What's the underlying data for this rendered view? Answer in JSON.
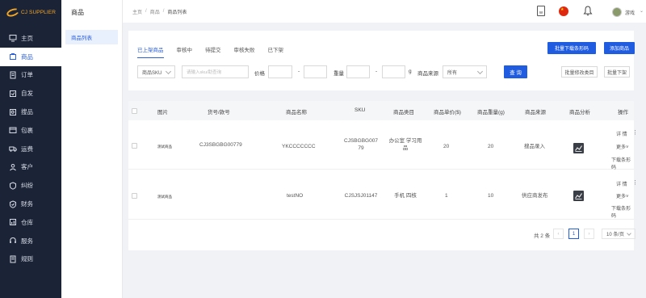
{
  "brand": {
    "logo_text": "CJ SUPPLIER"
  },
  "sidebar": {
    "items": [
      {
        "label": "主页",
        "icon": "monitor-icon"
      },
      {
        "label": "商品",
        "icon": "product-icon",
        "active": true
      },
      {
        "label": "订单",
        "icon": "order-icon"
      },
      {
        "label": "自发",
        "icon": "ship-icon"
      },
      {
        "label": "搜品",
        "icon": "search-product-icon"
      },
      {
        "label": "包裹",
        "icon": "package-icon"
      },
      {
        "label": "运费",
        "icon": "truck-icon"
      },
      {
        "label": "客户",
        "icon": "customer-icon"
      },
      {
        "label": "纠纷",
        "icon": "dispute-icon"
      },
      {
        "label": "财务",
        "icon": "finance-icon"
      },
      {
        "label": "仓库",
        "icon": "warehouse-icon"
      },
      {
        "label": "服务",
        "icon": "headset-icon"
      },
      {
        "label": "规则",
        "icon": "rules-icon"
      }
    ]
  },
  "submenu": {
    "title": "商品",
    "items": [
      "商品列表"
    ]
  },
  "breadcrumb": [
    "主页",
    "商品",
    "商品列表"
  ],
  "header": {
    "doc_icon_text": "W",
    "username": "游戏"
  },
  "tabs": [
    "已上架商品",
    "审核中",
    "待提交",
    "审核失败",
    "已下架"
  ],
  "actions": {
    "batch_download": "批量下载条形码",
    "add_product": "添加商品"
  },
  "filters": {
    "sku_select": "商品SKU",
    "sku_placeholder": "请输入sku/助查询",
    "price_label": "价格",
    "dash": "-",
    "weight_label": "重量",
    "weight_unit": "g",
    "source_label": "商品来源",
    "source_value": "所有",
    "query": "查 询",
    "batch_category": "批量修改类目",
    "batch_offline": "批量下架"
  },
  "table": {
    "headers": [
      "图片",
      "货号/款号",
      "商品名称",
      "SKU",
      "商品类目",
      "商品单价($)",
      "商品重量(g)",
      "商品来源",
      "商品分析",
      "操作"
    ],
    "rows": [
      {
        "image_text": "测试商品",
        "item_no": "CJ3SBGBG00779",
        "name": "YKCCCCCCC",
        "sku": [
          "CJSBGBG007",
          "79"
        ],
        "category": [
          "办公室 学习用",
          "品"
        ],
        "price": "20",
        "weight": "20",
        "source": "搜品录入"
      },
      {
        "image_text": "测试商品",
        "item_no": "",
        "name": "testNO",
        "sku": [
          "CJSJSJ01147",
          ""
        ],
        "category": [
          "手机 四核",
          ""
        ],
        "price": "1",
        "weight": "10",
        "source": "供应商发布"
      }
    ],
    "ops": {
      "detail": "详 情",
      "more": "更多",
      "download": "下载条形码"
    }
  },
  "pagination": {
    "total": "共 2 条",
    "current": "1",
    "page_size": "10 条/页"
  }
}
